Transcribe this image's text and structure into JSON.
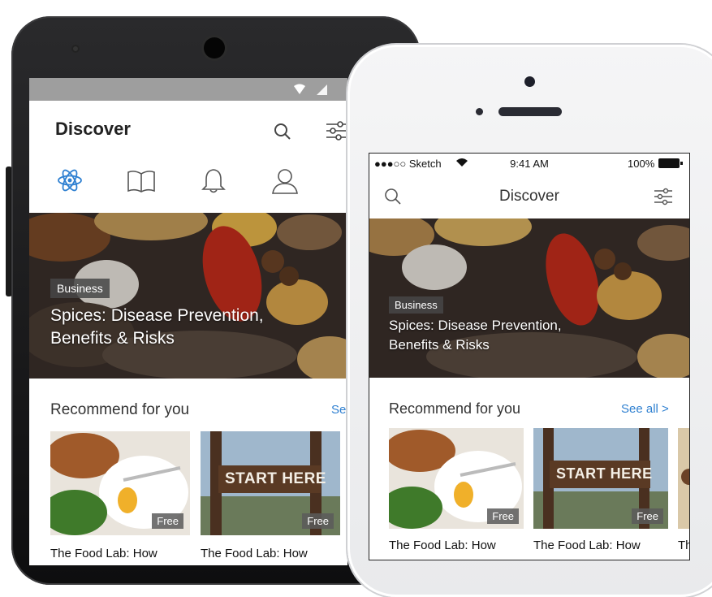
{
  "android": {
    "title": "Discover",
    "hero": {
      "category": "Business",
      "title_line1": "Spices: Disease Prevention,",
      "title_line2": "Benefits & Risks"
    },
    "recommend_title": "Recommend for you",
    "see_all": "See all",
    "cards": [
      {
        "tag": "Free",
        "title": "The Food Lab: How"
      },
      {
        "tag": "Free",
        "title": "The Food Lab: How"
      }
    ]
  },
  "iphone": {
    "status": {
      "carrier": "●●●○○ Sketch",
      "time": "9:41 AM",
      "battery": "100%"
    },
    "title": "Discover",
    "hero": {
      "category": "Business",
      "title_line1": "Spices: Disease Prevention,",
      "title_line2": "Benefits & Risks"
    },
    "recommend_title": "Recommend for you",
    "see_all": "See all",
    "cards": [
      {
        "tag": "Free",
        "title": "The Food Lab: How"
      },
      {
        "tag": "Free",
        "title": "The Food Lab: How"
      },
      {
        "tag": "",
        "title": "Th"
      }
    ],
    "card3_sign": "START HERE"
  },
  "sign_text": "START HERE",
  "icons": {
    "search": "search-icon",
    "filter": "filter-sliders-icon",
    "tabs": [
      "atom-icon",
      "book-icon",
      "bell-icon",
      "user-icon"
    ]
  },
  "colors": {
    "accent": "#2f80d1",
    "active_tab": "#2f80d1",
    "inactive_icon": "#555555"
  }
}
